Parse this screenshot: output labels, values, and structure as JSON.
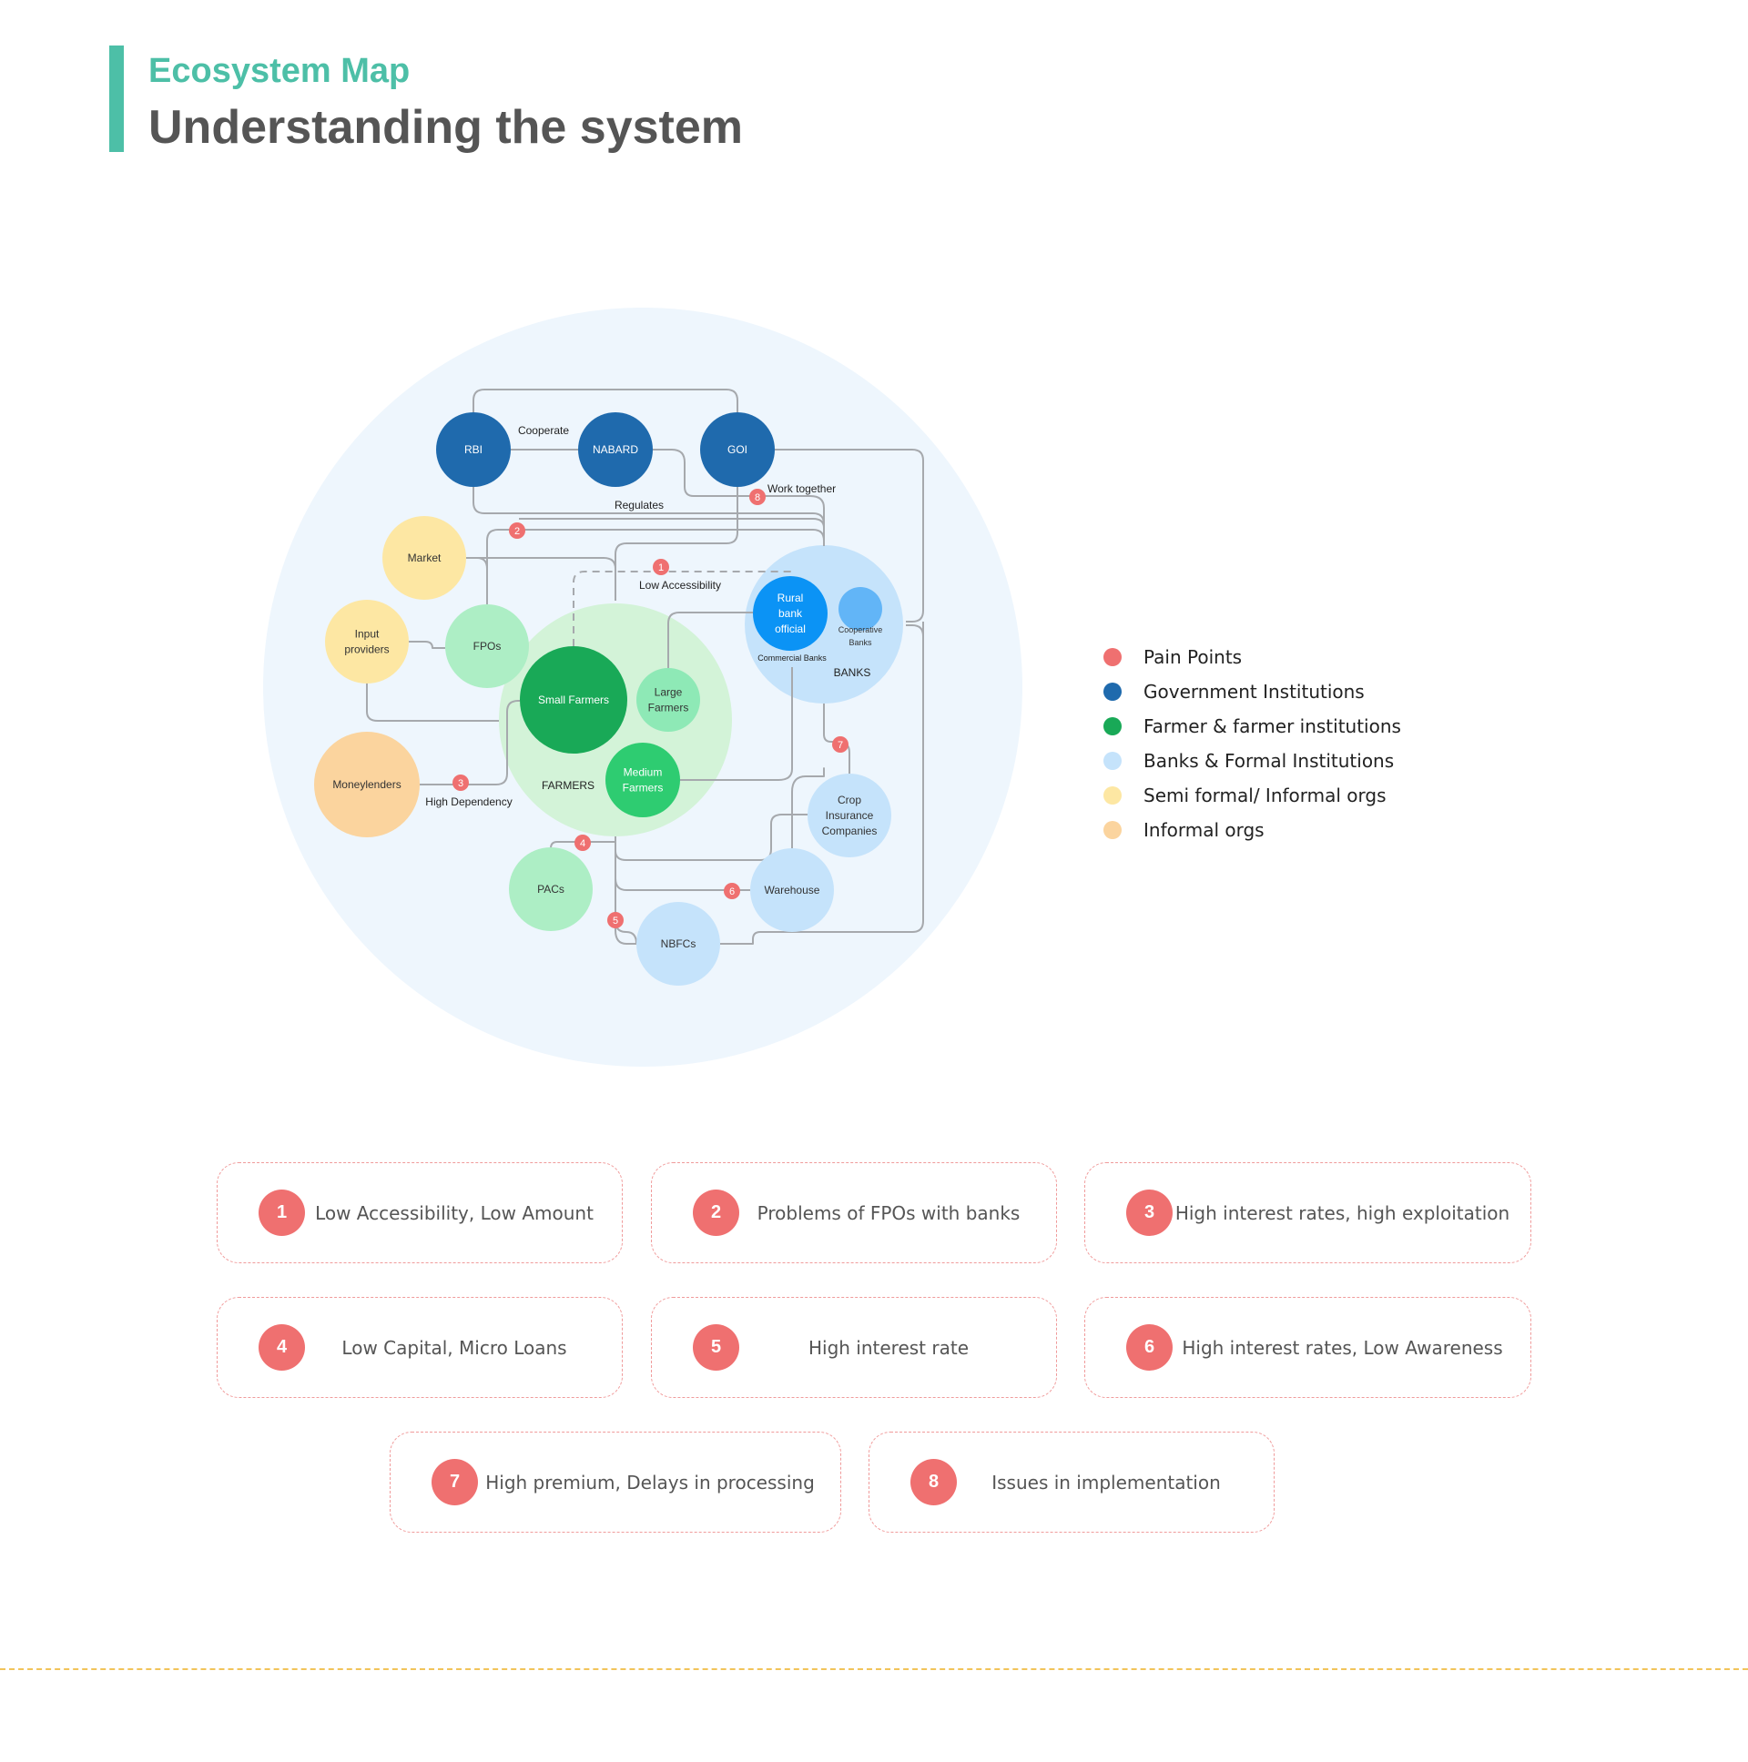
{
  "header": {
    "subtitle": "Ecosystem Map",
    "title": "Understanding the system"
  },
  "diagram": {
    "nodes": [
      {
        "id": "rbi",
        "lines": [
          "RBI"
        ],
        "category": "government"
      },
      {
        "id": "nabard",
        "lines": [
          "NABARD"
        ],
        "category": "government"
      },
      {
        "id": "goi",
        "lines": [
          "GOI"
        ],
        "category": "government"
      },
      {
        "id": "market",
        "lines": [
          "Market"
        ],
        "category": "semi_formal"
      },
      {
        "id": "input",
        "lines": [
          "Input",
          "providers"
        ],
        "category": "semi_formal"
      },
      {
        "id": "fpos",
        "lines": [
          "FPOs"
        ],
        "category": "farmer_light"
      },
      {
        "id": "moneylenders",
        "lines": [
          "Moneylenders"
        ],
        "category": "informal"
      },
      {
        "id": "small",
        "lines": [
          "Small Farmers"
        ],
        "category": "farmer_dark"
      },
      {
        "id": "large",
        "lines": [
          "Large",
          "Farmers"
        ],
        "category": "farmer_mid"
      },
      {
        "id": "medium",
        "lines": [
          "Medium",
          "Farmers"
        ],
        "category": "farmer_medium"
      },
      {
        "id": "rural",
        "lines": [
          "Rural",
          "bank",
          "official"
        ],
        "category": "bank_bright"
      },
      {
        "id": "coop",
        "lines": [
          "Cooperative",
          "Banks"
        ],
        "category": "bank_mid"
      },
      {
        "id": "crop",
        "lines": [
          "Crop",
          "Insurance",
          "Companies"
        ],
        "category": "bank"
      },
      {
        "id": "warehouse",
        "lines": [
          "Warehouse"
        ],
        "category": "bank"
      },
      {
        "id": "nbfcs",
        "lines": [
          "NBFCs"
        ],
        "category": "bank"
      },
      {
        "id": "pacs",
        "lines": [
          "PACs"
        ],
        "category": "farmer_light"
      }
    ],
    "group_labels": {
      "farmers": "FARMERS",
      "banks": "BANKS",
      "commercial_banks": "Commercial Banks"
    },
    "edge_labels": {
      "cooperate": "Cooperate",
      "regulates": "Regulates",
      "work_together": "Work together",
      "low_accessibility": "Low Accessibility",
      "high_dependency": "High Dependency"
    },
    "pain_markers": [
      "1",
      "2",
      "3",
      "4",
      "5",
      "6",
      "7",
      "8"
    ]
  },
  "legend": [
    {
      "label": "Pain Points",
      "color": "#ef7070"
    },
    {
      "label": "Government Institutions",
      "color": "#1f6aad"
    },
    {
      "label": "Farmer & farmer institutions",
      "color": "#19a957"
    },
    {
      "label": "Banks & Formal Institutions",
      "color": "#c5e3fb"
    },
    {
      "label": "Semi formal/ Informal orgs",
      "color": "#fde7a3"
    },
    {
      "label": "Informal orgs",
      "color": "#fbd49e"
    }
  ],
  "pain_points": [
    {
      "num": "1",
      "text": "Low Accessibility, Low Amount"
    },
    {
      "num": "2",
      "text": "Problems of FPOs with banks"
    },
    {
      "num": "3",
      "text": "High interest rates, high exploitation"
    },
    {
      "num": "4",
      "text": "Low Capital, Micro Loans"
    },
    {
      "num": "5",
      "text": "High interest rate"
    },
    {
      "num": "6",
      "text": "High interest rates, Low Awareness"
    },
    {
      "num": "7",
      "text": "High premium, Delays in processing"
    },
    {
      "num": "8",
      "text": "Issues in implementation"
    }
  ]
}
